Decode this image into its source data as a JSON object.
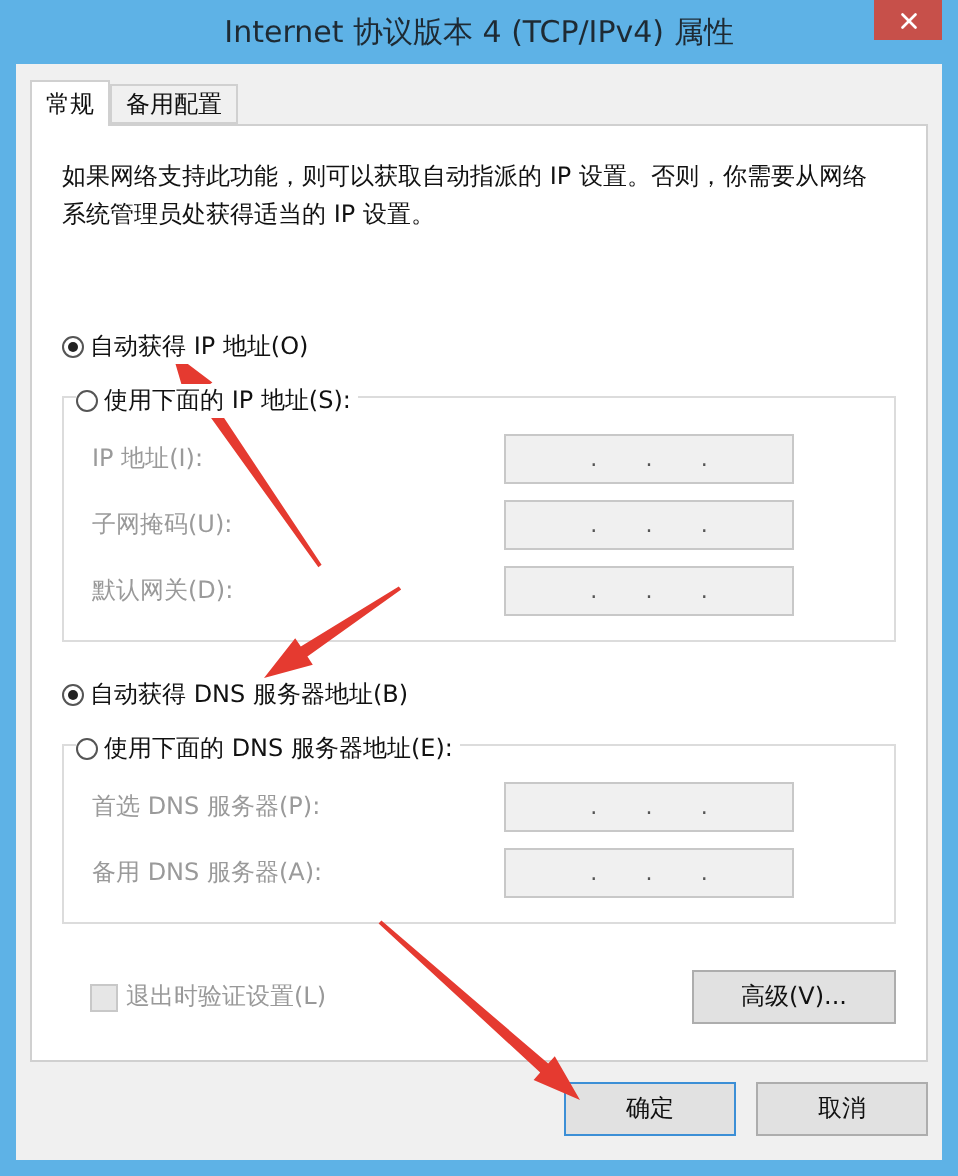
{
  "window": {
    "title": "Internet 协议版本 4 (TCP/IPv4) 属性"
  },
  "tabs": [
    {
      "label": "常规",
      "selected": true
    },
    {
      "label": "备用配置",
      "selected": false
    }
  ],
  "description": "如果网络支持此功能，则可以获取自动指派的 IP 设置。否则，你需要从网络系统管理员处获得适当的 IP 设置。",
  "ip_section": {
    "auto_option": {
      "label": "自动获得 IP 地址(O)",
      "selected": true
    },
    "manual_option": {
      "label": "使用下面的 IP 地址(S):",
      "selected": false
    },
    "fields": [
      {
        "label": "IP 地址(I):",
        "disabled": true,
        "separators": [
          ".",
          ".",
          "."
        ]
      },
      {
        "label": "子网掩码(U):",
        "disabled": true,
        "separators": [
          ".",
          ".",
          "."
        ]
      },
      {
        "label": "默认网关(D):",
        "disabled": true,
        "separators": [
          ".",
          ".",
          "."
        ]
      }
    ]
  },
  "dns_section": {
    "auto_option": {
      "label": "自动获得 DNS 服务器地址(B)",
      "selected": true
    },
    "manual_option": {
      "label": "使用下面的 DNS 服务器地址(E):",
      "selected": false
    },
    "fields": [
      {
        "label": "首选 DNS 服务器(P):",
        "disabled": true,
        "separators": [
          ".",
          ".",
          "."
        ]
      },
      {
        "label": "备用 DNS 服务器(A):",
        "disabled": true,
        "separators": [
          ".",
          ".",
          "."
        ]
      }
    ]
  },
  "validate_checkbox": {
    "label": "退出时验证设置(L)",
    "checked": false,
    "disabled": true
  },
  "advanced_button": "高级(V)...",
  "buttons": [
    {
      "label": "确定",
      "default": true
    },
    {
      "label": "取消",
      "default": false
    }
  ]
}
